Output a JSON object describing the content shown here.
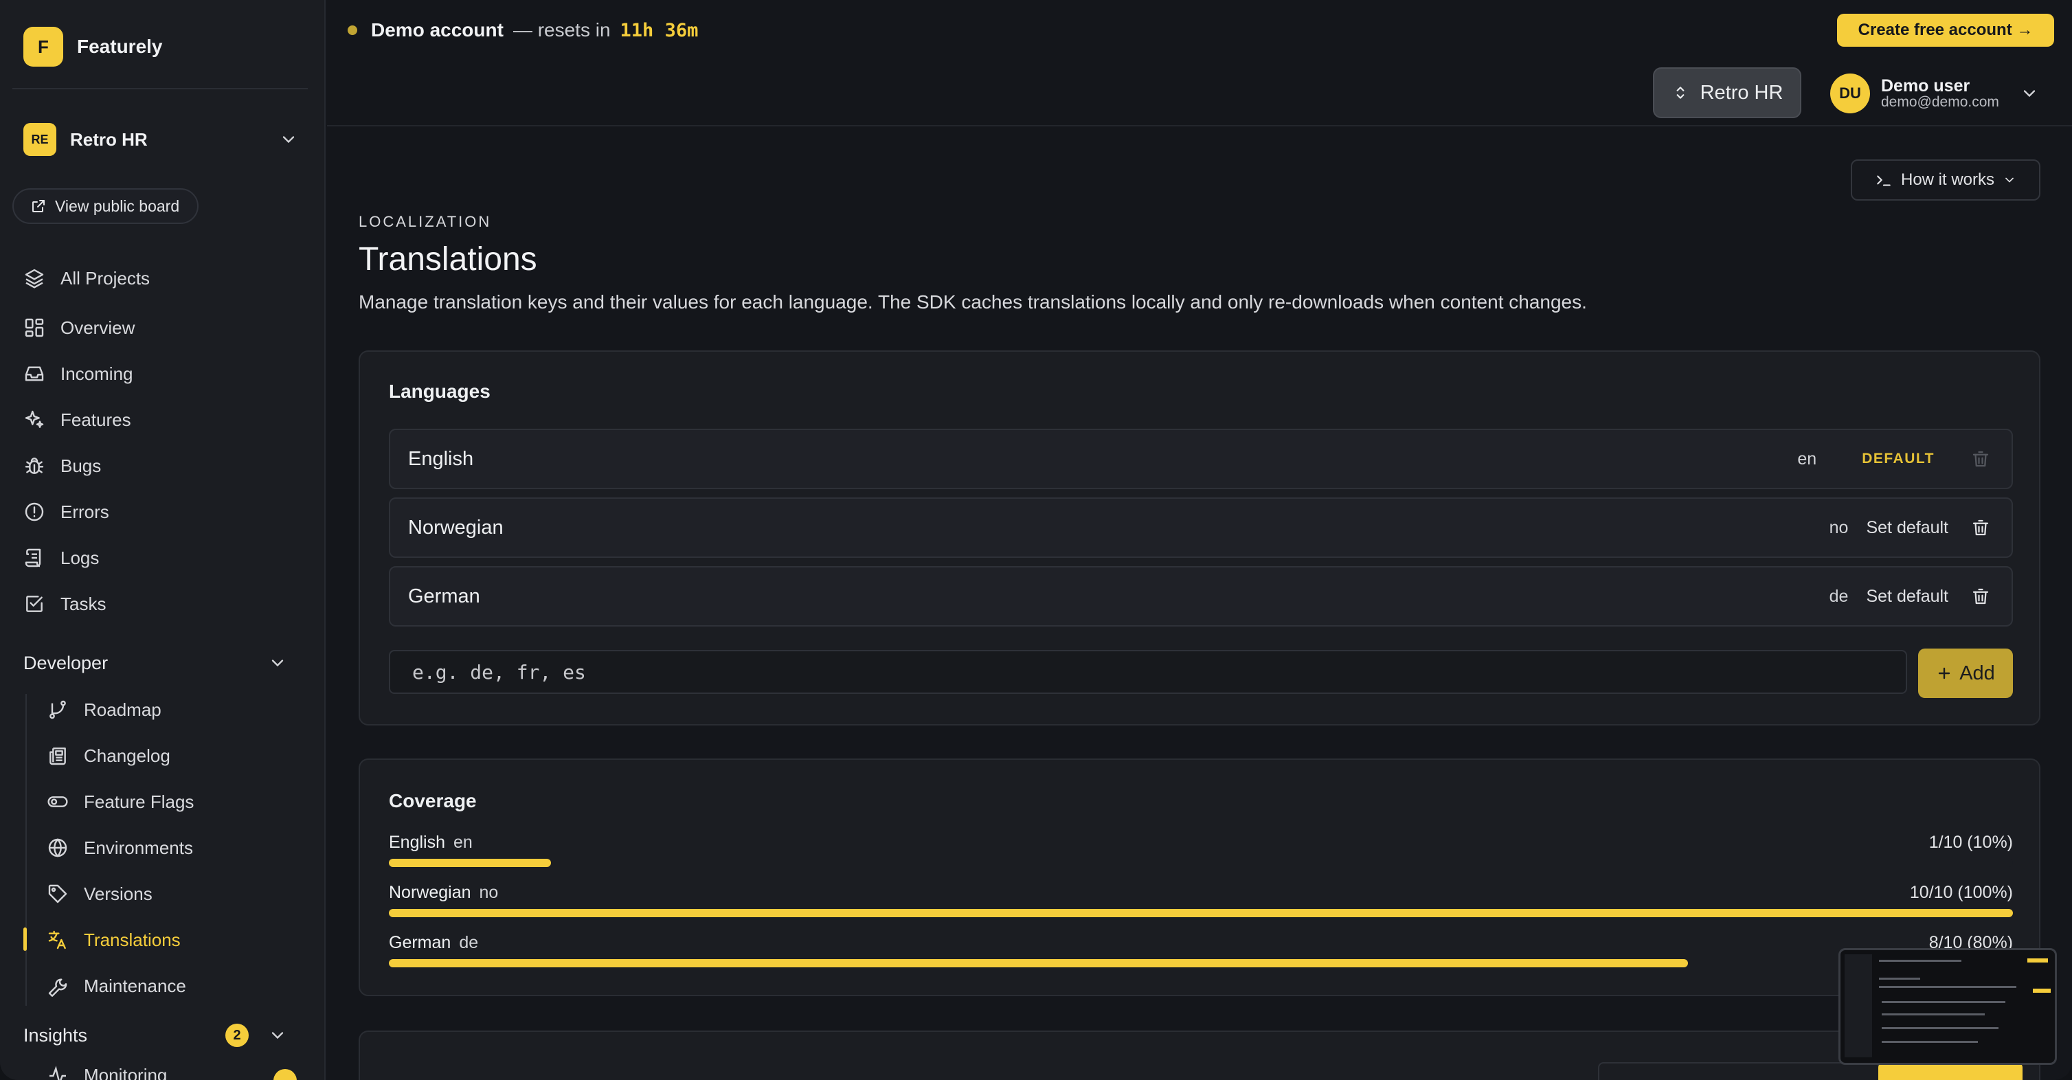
{
  "brand": {
    "logo_letter": "F",
    "name": "Featurely"
  },
  "project": {
    "initials": "RE",
    "name": "Retro HR"
  },
  "sidebar": {
    "public_board_label": "View public board",
    "all_projects": "All Projects",
    "items": [
      {
        "label": "Overview",
        "icon": "dashboard-icon"
      },
      {
        "label": "Incoming",
        "icon": "inbox-icon"
      },
      {
        "label": "Features",
        "icon": "sparkles-icon"
      },
      {
        "label": "Bugs",
        "icon": "bug-icon"
      },
      {
        "label": "Errors",
        "icon": "alert-circle-icon"
      },
      {
        "label": "Logs",
        "icon": "scroll-icon"
      },
      {
        "label": "Tasks",
        "icon": "checkbox-icon"
      }
    ],
    "developer": {
      "label": "Developer",
      "items": [
        {
          "label": "Roadmap",
          "icon": "git-branch-icon"
        },
        {
          "label": "Changelog",
          "icon": "newspaper-icon"
        },
        {
          "label": "Feature Flags",
          "icon": "toggle-icon"
        },
        {
          "label": "Environments",
          "icon": "globe-icon"
        },
        {
          "label": "Versions",
          "icon": "tag-icon"
        },
        {
          "label": "Translations",
          "icon": "languages-icon"
        },
        {
          "label": "Maintenance",
          "icon": "wrench-icon"
        }
      ]
    },
    "insights": {
      "label": "Insights",
      "badge": "2",
      "cut_item": "Monitoring"
    }
  },
  "topbar": {
    "demo_label": "Demo account",
    "demo_sep": "— resets in",
    "demo_timer": "11h 36m",
    "create_label": "Create free account →",
    "project_pill": "Retro HR",
    "user": {
      "initials": "DU",
      "name": "Demo user",
      "email": "demo@demo.com"
    }
  },
  "main": {
    "how_it_works": "How it works",
    "eyebrow": "LOCALIZATION",
    "title": "Translations",
    "description": "Manage translation keys and their values for each language. The SDK caches translations locally and only re-downloads when content changes.",
    "languages": {
      "title": "Languages",
      "rows": [
        {
          "name": "English",
          "code": "en",
          "default_label": "DEFAULT"
        },
        {
          "name": "Norwegian",
          "code": "no",
          "action": "Set default"
        },
        {
          "name": "German",
          "code": "de",
          "action": "Set default"
        }
      ],
      "input_placeholder": "e.g. de, fr, es",
      "add_label": "Add"
    },
    "coverage": {
      "title": "Coverage",
      "rows": [
        {
          "name": "English",
          "code": "en",
          "value": "1/10 (10%)",
          "fraction": 0.1
        },
        {
          "name": "Norwegian",
          "code": "no",
          "value": "10/10 (100%)",
          "fraction": 1.0
        },
        {
          "name": "German",
          "code": "de",
          "value": "8/10 (80%)",
          "fraction": 0.8
        }
      ]
    }
  },
  "colors": {
    "accent": "#f5cd3b",
    "background": "#14161b",
    "sidebar": "#1b1d22"
  }
}
